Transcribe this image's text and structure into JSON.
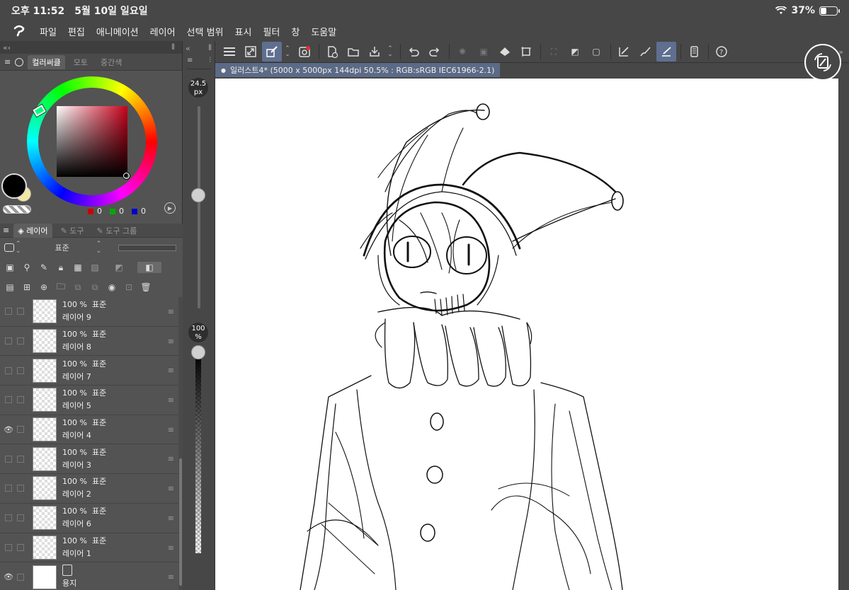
{
  "status": {
    "time": "오후 11:52",
    "date": "5월 10일 일요일",
    "battery": "37%",
    "battery_level": 0.37
  },
  "menu": {
    "items": [
      "파일",
      "편집",
      "애니메이션",
      "레이어",
      "선택 범위",
      "표시",
      "필터",
      "창",
      "도움말"
    ]
  },
  "color_panel": {
    "tabs": [
      "컬러써클",
      "모토",
      "중간색"
    ],
    "r": "0",
    "g": "0",
    "b": "0",
    "main_color": "#000000",
    "sub_color": "#f3e7a0"
  },
  "layer_panel": {
    "tabs": [
      "레이어",
      "도구",
      "도구 그룹"
    ],
    "blend_mode": "표준",
    "layers": [
      {
        "opacity": "100 %",
        "mode": "표준",
        "name": "레이어 9",
        "visible": false
      },
      {
        "opacity": "100 %",
        "mode": "표준",
        "name": "레이어 8",
        "visible": false
      },
      {
        "opacity": "100 %",
        "mode": "표준",
        "name": "레이어 7",
        "visible": false
      },
      {
        "opacity": "100 %",
        "mode": "표준",
        "name": "레이어 5",
        "visible": false
      },
      {
        "opacity": "100 %",
        "mode": "표준",
        "name": "레이어 4",
        "visible": true
      },
      {
        "opacity": "100 %",
        "mode": "표준",
        "name": "레이어 3",
        "visible": false
      },
      {
        "opacity": "100 %",
        "mode": "표준",
        "name": "레이어 2",
        "visible": false
      },
      {
        "opacity": "100 %",
        "mode": "표준",
        "name": "레이어 6",
        "visible": false
      },
      {
        "opacity": "100 %",
        "mode": "표준",
        "name": "레이어 1",
        "visible": false
      }
    ],
    "paper_layer": {
      "name": "용지",
      "visible": true
    }
  },
  "brush": {
    "size_value": "24.5",
    "size_unit": "px",
    "opacity_value": "100",
    "opacity_unit": "%"
  },
  "document": {
    "tab_title": "일러스트4* (5000 x 5000px 144dpi 50.5% : RGB:sRGB IEC61966-2.1)"
  },
  "colors": {
    "ui_bg": "#474747",
    "panel_bg": "#535353",
    "accent": "#5b6a86",
    "canvas": "#ffffff"
  }
}
